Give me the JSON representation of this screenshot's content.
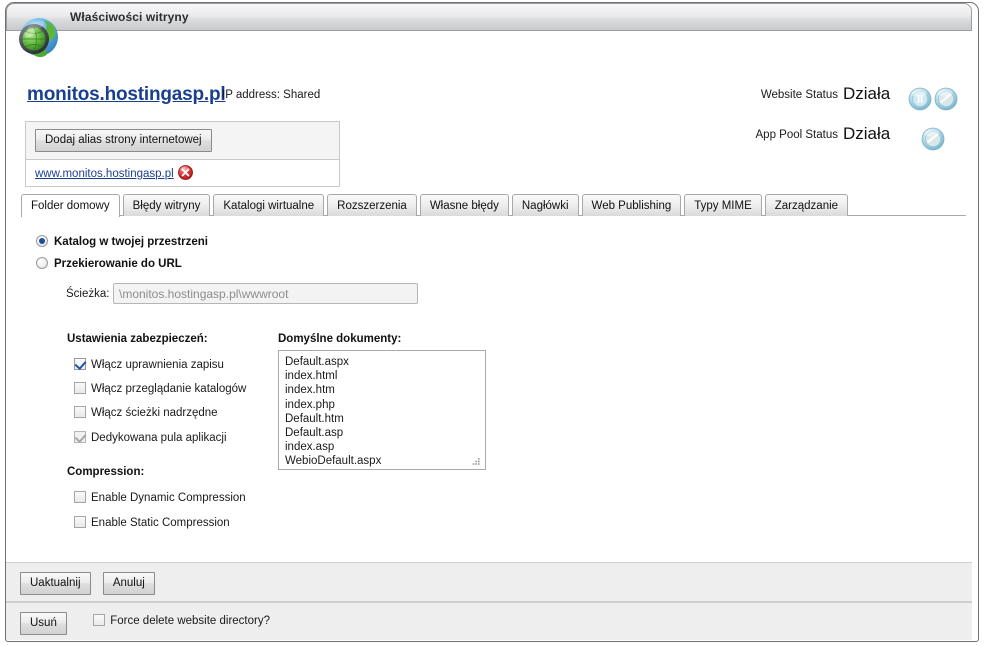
{
  "window": {
    "title": "Właściwości witryny",
    "icon": "globe-icon"
  },
  "site": {
    "domain": "monitos.hostingasp.pl",
    "ip_address": "IP address: Shared"
  },
  "status": {
    "website": {
      "label": "Website Status",
      "value": "Działa",
      "icons": [
        "pause-icon",
        "stop-icon"
      ]
    },
    "app_pool": {
      "label": "App Pool Status",
      "value": "Działa",
      "icons": [
        "stop-icon"
      ]
    }
  },
  "alias": {
    "add_button": "Dodaj alias strony internetowej",
    "entries": [
      {
        "name": "www.monitos.hostingasp.pl",
        "delete_icon": "delete-icon"
      }
    ]
  },
  "tabs": [
    {
      "label": "Folder domowy",
      "active": true
    },
    {
      "label": "Błędy witryny",
      "active": false
    },
    {
      "label": "Katalogi wirtualne",
      "active": false
    },
    {
      "label": "Rozszerzenia",
      "active": false
    },
    {
      "label": "Własne błędy",
      "active": false
    },
    {
      "label": "Nagłówki",
      "active": false
    },
    {
      "label": "Web Publishing",
      "active": false
    },
    {
      "label": "Typy MIME",
      "active": false
    },
    {
      "label": "Zarządzanie",
      "active": false
    }
  ],
  "home_directory": {
    "radios": [
      {
        "label": "Katalog w twojej przestrzeni",
        "checked": true
      },
      {
        "label": "Przekierowanie do URL",
        "checked": false
      }
    ],
    "path_label": "Ścieżka:",
    "path_value": "\\monitos.hostingasp.pl\\wwwroot",
    "security": {
      "heading": "Ustawienia zabezpieczeń:",
      "items": [
        {
          "label": "Włącz uprawnienia zapisu",
          "state": "checked"
        },
        {
          "label": "Włącz przeglądanie katalogów",
          "state": "unchecked"
        },
        {
          "label": "Włącz ścieżki nadrzędne",
          "state": "unchecked"
        },
        {
          "label": "Dedykowana pula aplikacji",
          "state": "checked-disabled"
        }
      ]
    },
    "compression": {
      "heading": "Compression:",
      "items": [
        {
          "label": "Enable Dynamic Compression",
          "state": "unchecked"
        },
        {
          "label": "Enable Static Compression",
          "state": "unchecked"
        }
      ]
    },
    "documents": {
      "heading": "Domyślne dokumenty:",
      "value": "Default.aspx\nindex.html\nindex.htm\nindex.php\nDefault.htm\nDefault.asp\nindex.asp\nWebioDefault.aspx"
    }
  },
  "footer": {
    "update_button": "Uaktualnij",
    "cancel_button": "Anuluj",
    "delete_button": "Usuń",
    "force_delete_label": "Force delete website directory?",
    "force_delete_checked": false
  },
  "colors": {
    "link": "#1b3f8f",
    "accent_check": "#2254a4",
    "delete_red": "#cf2222",
    "glass_blue": "#a9d3e4"
  }
}
